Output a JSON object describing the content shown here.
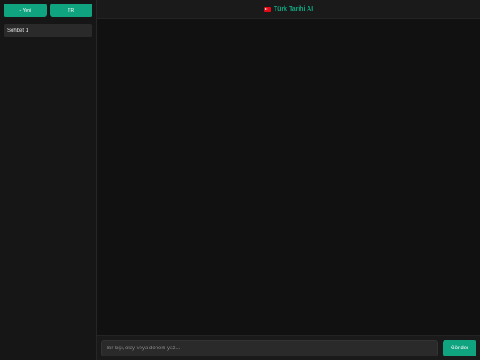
{
  "sidebar": {
    "new_label": "+ Yeni",
    "lang_label": "TR",
    "chats": [
      {
        "label": "Sohbet 1"
      }
    ]
  },
  "header": {
    "flag_icon": "turkey-flag-icon",
    "title": "Türk Tarihi AI"
  },
  "composer": {
    "placeholder": "Bir kişi, olay veya dönem yaz...",
    "value": "",
    "send_label": "Gönder"
  },
  "colors": {
    "accent": "#10a37f",
    "background": "#111111",
    "sidebar": "#161616",
    "item": "#2a2a2a"
  }
}
